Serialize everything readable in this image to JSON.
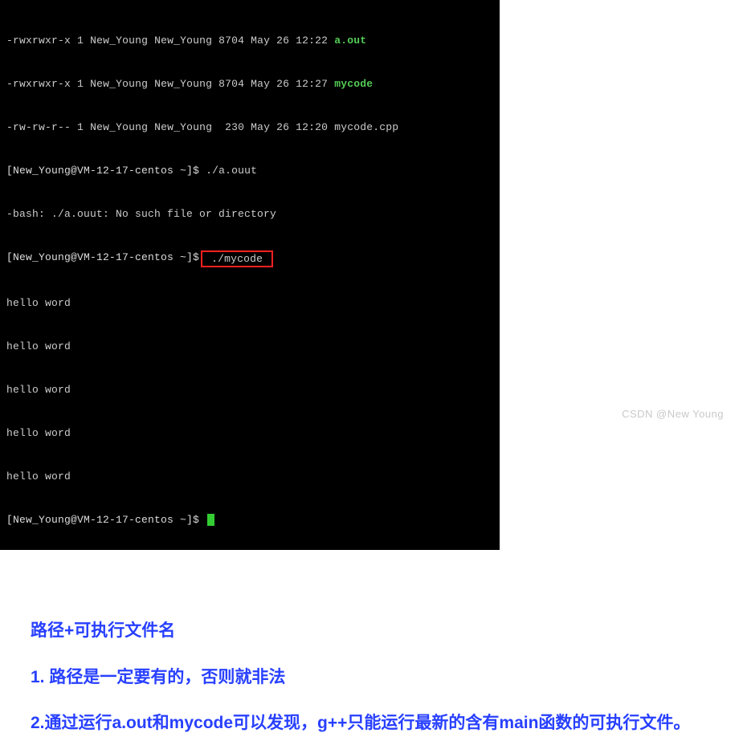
{
  "terminal": {
    "ls": [
      {
        "perm": "-rwxrwxr-x",
        "links": "1",
        "owner": "New_Young",
        "group": "New_Young",
        "size": "8704",
        "date": "May 26 12:22",
        "name": "a.out",
        "color": "lime"
      },
      {
        "perm": "-rwxrwxr-x",
        "links": "1",
        "owner": "New_Young",
        "group": "New_Young",
        "size": "8704",
        "date": "May 26 12:27",
        "name": "mycode",
        "color": "lime"
      },
      {
        "perm": "-rw-rw-r--",
        "links": "1",
        "owner": "New_Young",
        "group": "New_Young",
        "size": " 230",
        "date": "May 26 12:20",
        "name": "mycode.cpp",
        "color": ""
      }
    ],
    "prompt": "[New_Young@VM-12-17-centos ~]$",
    "cmd1": "./a.ouut",
    "error1": "-bash: ./a.ouut: No such file or directory",
    "cmd2": "./mycode",
    "output_line": "hello word",
    "output_count": 5
  },
  "notes": {
    "line1": "路径+可执行文件名",
    "line2": "1. 路径是一定要有的，否则就非法",
    "line3": "2.通过运行a.out和mycode可以发现，g++只能运行最新的含有main函数的可执行文件。"
  },
  "watermark": "CSDN @New  Young"
}
